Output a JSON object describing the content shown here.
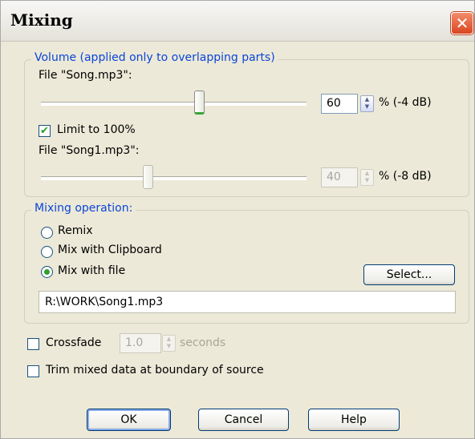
{
  "window": {
    "title": "Mixing",
    "close_glyph": "✕"
  },
  "volume": {
    "legend": "Volume (applied only to overlapping parts)",
    "file1": {
      "label": "File \"Song.mp3\":",
      "percent": 60,
      "value": "60",
      "db_label": "% (-4 dB)",
      "slider_fraction": 0.6
    },
    "limit": {
      "label": "Limit to 100%",
      "checked": true
    },
    "file2": {
      "label": "File \"Song1.mp3\":",
      "percent": 40,
      "value": "40",
      "db_label": "% (-8 dB)",
      "slider_fraction": 0.4,
      "enabled": false
    }
  },
  "mixing_operation": {
    "legend": "Mixing operation:",
    "options": [
      {
        "label": "Remix",
        "selected": false
      },
      {
        "label": "Mix with Clipboard",
        "selected": false
      },
      {
        "label": "Mix with file",
        "selected": true
      }
    ],
    "select_button": "Select...",
    "file_path": "R:\\WORK\\Song1.mp3"
  },
  "crossfade": {
    "label": "Crossfade",
    "checked": false,
    "value": "1.0",
    "unit": "seconds",
    "enabled": false
  },
  "trim": {
    "label": "Trim mixed data at boundary of source",
    "checked": false
  },
  "buttons": {
    "ok": "OK",
    "cancel": "Cancel",
    "help": "Help"
  },
  "icons": {
    "spin_up": "▲",
    "spin_down": "▼",
    "check": "✔"
  },
  "colors": {
    "legend": "#0b46d8",
    "check": "#21a121",
    "dialog_bg": "#ece9d8"
  }
}
